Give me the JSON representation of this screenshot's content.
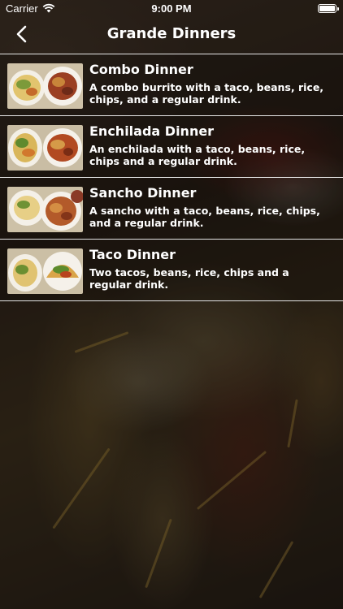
{
  "status_bar": {
    "carrier": "Carrier",
    "time": "9:00 PM",
    "wifi_icon": "wifi-icon",
    "battery_icon": "battery-full-icon"
  },
  "nav": {
    "back_icon": "chevron-left-icon",
    "title": "Grande Dinners"
  },
  "menu": {
    "items": [
      {
        "title": "Combo Dinner",
        "description": "A combo burrito with a taco, beans, rice, chips, and a regular drink."
      },
      {
        "title": "Enchilada Dinner",
        "description": "An enchilada with a taco, beans, rice, chips and a regular drink."
      },
      {
        "title": "Sancho Dinner",
        "description": "A sancho with a taco, beans, rice, chips, and a regular drink."
      },
      {
        "title": "Taco Dinner",
        "description": "Two tacos, beans, rice, chips and a regular drink."
      }
    ]
  },
  "colors": {
    "text": "#ffffff",
    "divider": "#e6e6e6"
  }
}
